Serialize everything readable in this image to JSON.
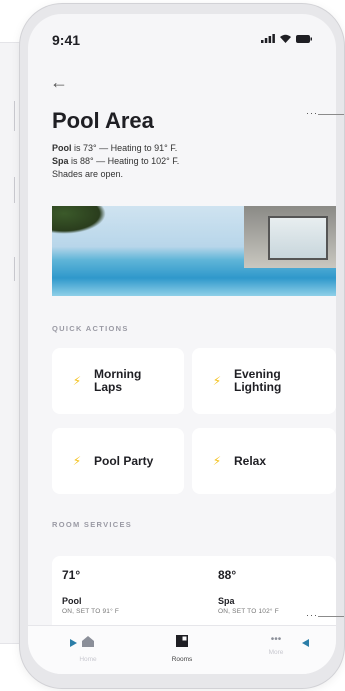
{
  "status_bar": {
    "time": "9:41",
    "icons": [
      "signal-icon",
      "wifi-icon",
      "battery-icon"
    ]
  },
  "header": {
    "back_icon": "back-arrow-icon",
    "title": "Pool Area"
  },
  "summary": {
    "pool_name": "Pool",
    "pool_text": " is 73° — Heating to 91° F.",
    "spa_name": "Spa",
    "spa_text": " is 88° — Heating to 102° F.",
    "shades_text": "Shades are open."
  },
  "quick_actions": {
    "label": "QUICK ACTIONS",
    "items": [
      {
        "line1": "Morning",
        "line2": "Laps",
        "icon": "bolt-icon"
      },
      {
        "line1": "Evening",
        "line2": "Lighting",
        "icon": "bolt-icon"
      },
      {
        "line1": "Pool Party",
        "line2": "",
        "icon": "bolt-icon"
      },
      {
        "line1": "Relax",
        "line2": "",
        "icon": "bolt-icon"
      }
    ]
  },
  "room_services": {
    "label": "ROOM SERVICES",
    "items": [
      {
        "temp": "71°",
        "name": "Pool",
        "state": "ON, SET TO 91° F"
      },
      {
        "temp": "88°",
        "name": "Spa",
        "state": "ON, SET TO 102° F"
      }
    ]
  },
  "tab_bar": {
    "tabs": [
      {
        "label": "Home",
        "icon": "home-icon"
      },
      {
        "label": "Rooms",
        "icon": "rooms-icon"
      },
      {
        "label": "More",
        "icon": "more-icon"
      }
    ]
  },
  "colors": {
    "accent_bolt": "#f4c21d",
    "arrow": "#2c7ea8",
    "card_bg": "#ffffff",
    "screen_bg": "#f6f6f8"
  }
}
